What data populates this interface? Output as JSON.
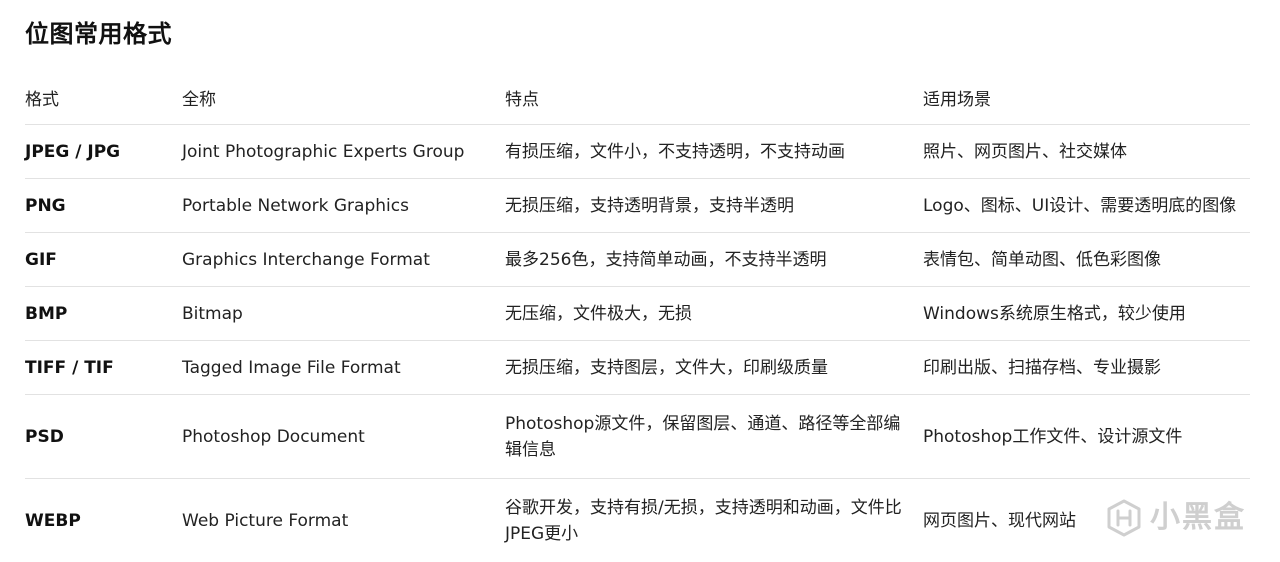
{
  "title": "位图常用格式",
  "table": {
    "headers": [
      "格式",
      "全称",
      "特点",
      "适用场景"
    ],
    "rows": [
      {
        "format": "JPEG / JPG",
        "full_name": "Joint Photographic Experts Group",
        "features": "有损压缩，文件小，不支持透明，不支持动画",
        "use_cases": "照片、网页图片、社交媒体"
      },
      {
        "format": "PNG",
        "full_name": "Portable Network Graphics",
        "features": "无损压缩，支持透明背景，支持半透明",
        "use_cases": "Logo、图标、UI设计、需要透明底的图像"
      },
      {
        "format": "GIF",
        "full_name": "Graphics Interchange Format",
        "features": "最多256色，支持简单动画，不支持半透明",
        "use_cases": "表情包、简单动图、低色彩图像"
      },
      {
        "format": "BMP",
        "full_name": "Bitmap",
        "features": "无压缩，文件极大，无损",
        "use_cases": "Windows系统原生格式，较少使用"
      },
      {
        "format": "TIFF / TIF",
        "full_name": "Tagged Image File Format",
        "features": "无损压缩，支持图层，文件大，印刷级质量",
        "use_cases": "印刷出版、扫描存档、专业摄影"
      },
      {
        "format": "PSD",
        "full_name": "Photoshop Document",
        "features": "Photoshop源文件，保留图层、通道、路径等全部编辑信息",
        "use_cases": "Photoshop工作文件、设计源文件"
      },
      {
        "format": "WEBP",
        "full_name": "Web Picture Format",
        "features": "谷歌开发，支持有损/无损，支持透明和动画，文件比JPEG更小",
        "use_cases": "网页图片、现代网站"
      }
    ]
  },
  "watermark": {
    "text": "小黑盒",
    "icon": "heybox-logo-icon"
  },
  "colors": {
    "text": "#222222",
    "heading": "#111111",
    "divider": "#e2e2e2",
    "watermark": "#cfcfcf"
  }
}
